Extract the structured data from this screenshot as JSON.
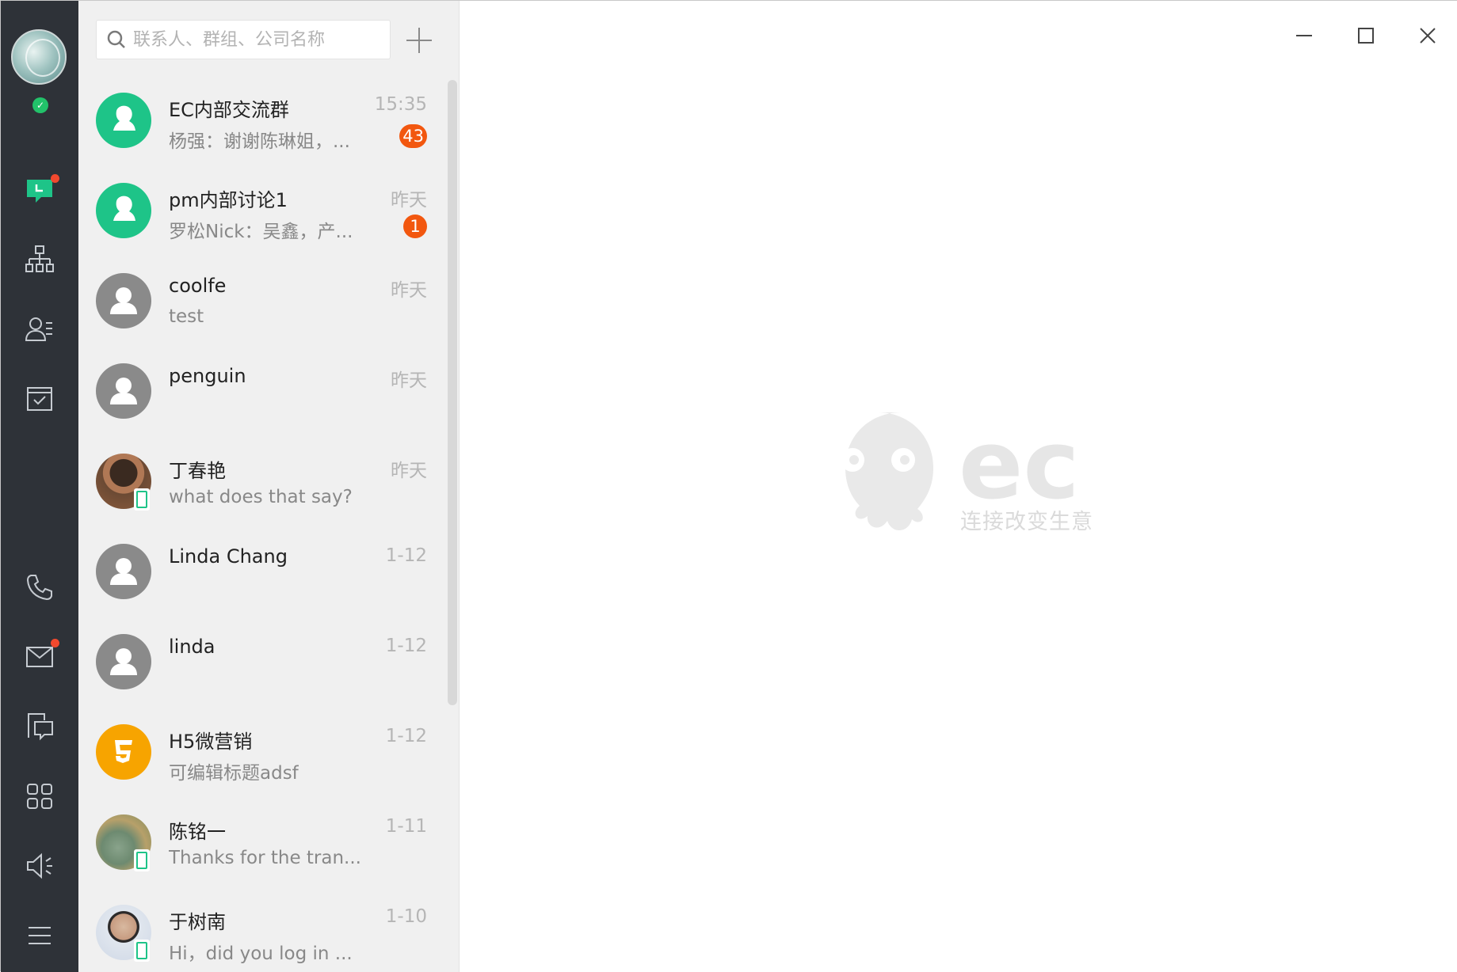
{
  "search": {
    "placeholder": "联系人、群组、公司名称"
  },
  "sessions": [
    {
      "name": "EC内部交流群",
      "preview": "杨强：谢谢陈琳姐，...",
      "time": "15:35",
      "badge": "43"
    },
    {
      "name": "pm内部讨论1",
      "preview": "罗松Nick：吴鑫，产...",
      "time": "昨天",
      "badge": "1"
    },
    {
      "name": "coolfe",
      "preview": "test",
      "time": "昨天"
    },
    {
      "name": "penguin",
      "preview": "",
      "time": "昨天"
    },
    {
      "name": "丁春艳",
      "preview": "what does that say?",
      "time": "昨天"
    },
    {
      "name": "Linda Chang",
      "preview": "",
      "time": "1-12"
    },
    {
      "name": "linda",
      "preview": "",
      "time": "1-12"
    },
    {
      "name": "H5微营销",
      "preview": "可编辑标题adsf",
      "time": "1-12"
    },
    {
      "name": "陈铭一",
      "preview": "Thanks for the tran...",
      "time": "1-11"
    },
    {
      "name": "于树南",
      "preview": "Hi，did you log in ...",
      "time": "1-10"
    }
  ],
  "main": {
    "slogan": "连接改变生意",
    "logo_text": "ec"
  },
  "colors": {
    "nav_bg": "#2e3238",
    "accent": "#1ec488",
    "badge": "#f2570f",
    "notify_dot": "#f2492e"
  },
  "icons": [
    "search-icon",
    "plus-icon",
    "chat-icon",
    "org-chart-icon",
    "contacts-icon",
    "task-icon",
    "phone-icon",
    "mail-icon",
    "chat-docs-icon",
    "apps-icon",
    "speaker-icon",
    "menu-icon",
    "minimize-icon",
    "maximize-icon",
    "close-icon"
  ]
}
